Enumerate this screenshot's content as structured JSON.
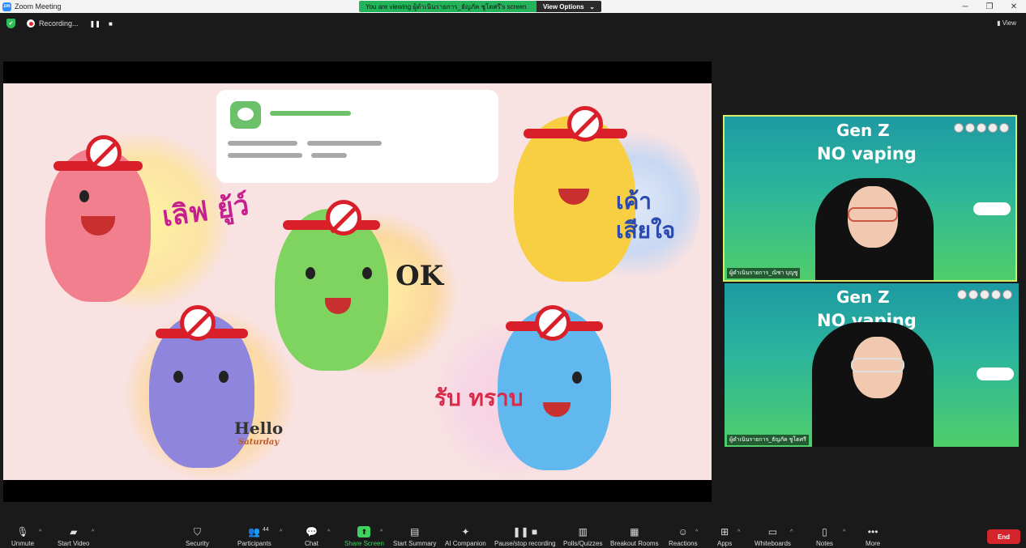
{
  "window": {
    "title": "Zoom Meeting",
    "logo_text": "zm",
    "minimize": "─",
    "maximize": "❐",
    "close": "✕"
  },
  "share_banner": {
    "message": "You are viewing ผู้ดำเนินรายการ_ธัญภัค ชูโตศรี's screen",
    "button": "View Options",
    "caret": "⌄"
  },
  "topbar": {
    "recording_label": "Recording...",
    "pause": "❚❚",
    "stop": "■",
    "view_label": "View",
    "shield_glyph": "✔"
  },
  "slide": {
    "thai_top_left": "เลิฟ ยู้ว์",
    "ok_text": "OK",
    "thai_top_right": "เค้า เสียใจ",
    "thai_bottom_right": "รับ ทราบ",
    "hello_text": "Hello",
    "saturday_text": "Saturday"
  },
  "participants": [
    {
      "name": "ผู้ดำเนินรายการ_ณิชา บุญชู",
      "bg_title_1": "Gen Z",
      "bg_title_2": "NO vaping",
      "active": true
    },
    {
      "name": "ผู้ดำเนินรายการ_ธัญภัค ชูโตศรี",
      "bg_title_1": "Gen Z",
      "bg_title_2": "NO vaping",
      "active": false
    }
  ],
  "toolbar": {
    "unmute": "Unmute",
    "start_video": "Start Video",
    "security": "Security",
    "participants": "Participants",
    "participants_count": "44",
    "chat": "Chat",
    "share_screen": "Share Screen",
    "start_summary": "Start Summary",
    "ai_companion": "AI Companion",
    "pause_recording": "Pause/stop recording",
    "polls": "Polls/Quizzes",
    "breakout": "Breakout Rooms",
    "reactions": "Reactions",
    "apps": "Apps",
    "whiteboards": "Whiteboards",
    "notes": "Notes",
    "more": "More",
    "end": "End"
  },
  "colors": {
    "share_green": "#23b35a",
    "end_red": "#d3252b",
    "active_border": "#d8ec6c"
  }
}
